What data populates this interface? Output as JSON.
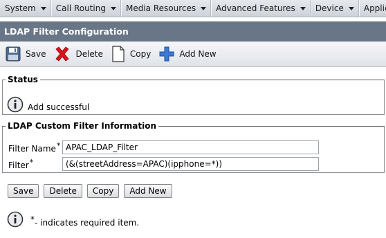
{
  "menu": [
    {
      "label": "System"
    },
    {
      "label": "Call Routing"
    },
    {
      "label": "Media Resources"
    },
    {
      "label": "Advanced Features"
    },
    {
      "label": "Device"
    },
    {
      "label": "Application"
    }
  ],
  "page": {
    "title": "LDAP Filter Configuration"
  },
  "toolbar": {
    "save_label": "Save",
    "delete_label": "Delete",
    "copy_label": "Copy",
    "add_new_label": "Add New"
  },
  "status": {
    "legend": "Status",
    "message": "Add successful",
    "icon": "info-icon"
  },
  "custom_filter": {
    "legend": "LDAP Custom Filter Information",
    "filter_name_label": "Filter Name",
    "filter_name_value": "APAC_LDAP_Filter",
    "filter_label": "Filter",
    "filter_value": "(&(streetAddress=APAC)(ipphone=*))",
    "required_mark": "*"
  },
  "buttons": {
    "save": "Save",
    "delete": "Delete",
    "copy": "Copy",
    "add_new": "Add New"
  },
  "footer": {
    "required_mark": "*",
    "note": "- indicates required item."
  },
  "colors": {
    "title_bar": "#697688",
    "delete_icon": "#d9151b",
    "add_icon": "#3b7ad6"
  }
}
